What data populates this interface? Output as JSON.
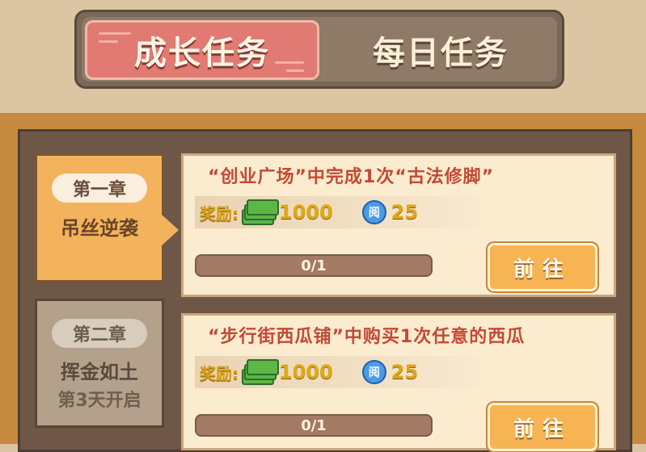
{
  "tabs": [
    {
      "label": "成长任务",
      "active": true
    },
    {
      "label": "每日任务",
      "active": false
    }
  ],
  "chapters": [
    {
      "number": "第一章",
      "name": "吊丝逆袭",
      "status": "active"
    },
    {
      "number": "第二章",
      "name": "挥金如土",
      "unlock": "第3天开启",
      "status": "locked"
    }
  ],
  "tasks": [
    {
      "description": "“创业广场”中完成1次“古法修脚”",
      "reward_label": "奖励:",
      "cash": "1000",
      "coin_icon_text": "阅",
      "coin": "25",
      "progress": "0/1",
      "button": "前往"
    },
    {
      "description": "“步行街西瓜铺”中购买1次任意的西瓜",
      "reward_label": "奖励:",
      "cash": "1000",
      "coin_icon_text": "阅",
      "coin": "25",
      "progress": "0/1",
      "button": "前往"
    }
  ],
  "colors": {
    "tab_active": "#e07a72",
    "chapter_active": "#f2b35c",
    "task_text": "#c24a34",
    "reward_gold": "#e0a818"
  },
  "icons": [
    "cash-icon",
    "coin-icon"
  ]
}
